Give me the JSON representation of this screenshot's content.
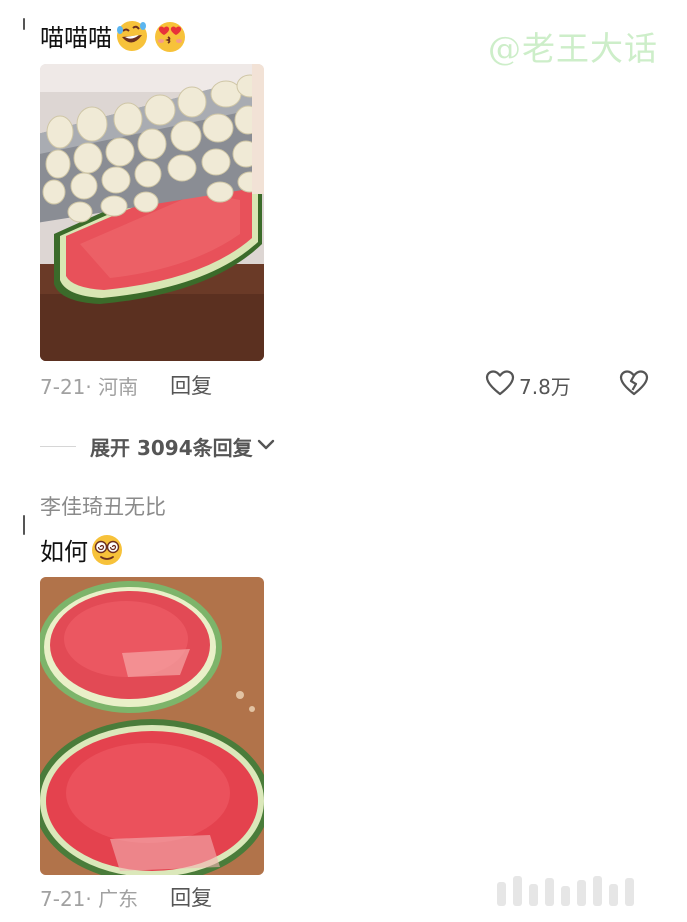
{
  "watermark": "@老王大话",
  "comments": [
    {
      "username": "",
      "text": "喵喵喵",
      "emojis": [
        "rofl-emoji",
        "heart-eyes-kiss-emoji"
      ],
      "media": "watermelon-cut-with-garlic-knife-image",
      "date": "7-21· 河南",
      "reply_label": "回复",
      "like_count": "7.8万",
      "expand_label": "展开 3094条回复"
    },
    {
      "username": "李佳琦丑无比",
      "text": "如何",
      "emojis": [
        "dizzy-eyes-emoji"
      ],
      "media": "hollowed-watermelon-halves-image",
      "date": "7-21· 广东",
      "reply_label": "回复"
    }
  ],
  "colors": {
    "watermark": "#cdeec9",
    "meta_gray": "#a1a1a1",
    "watermelon_red": "#e8515a"
  }
}
